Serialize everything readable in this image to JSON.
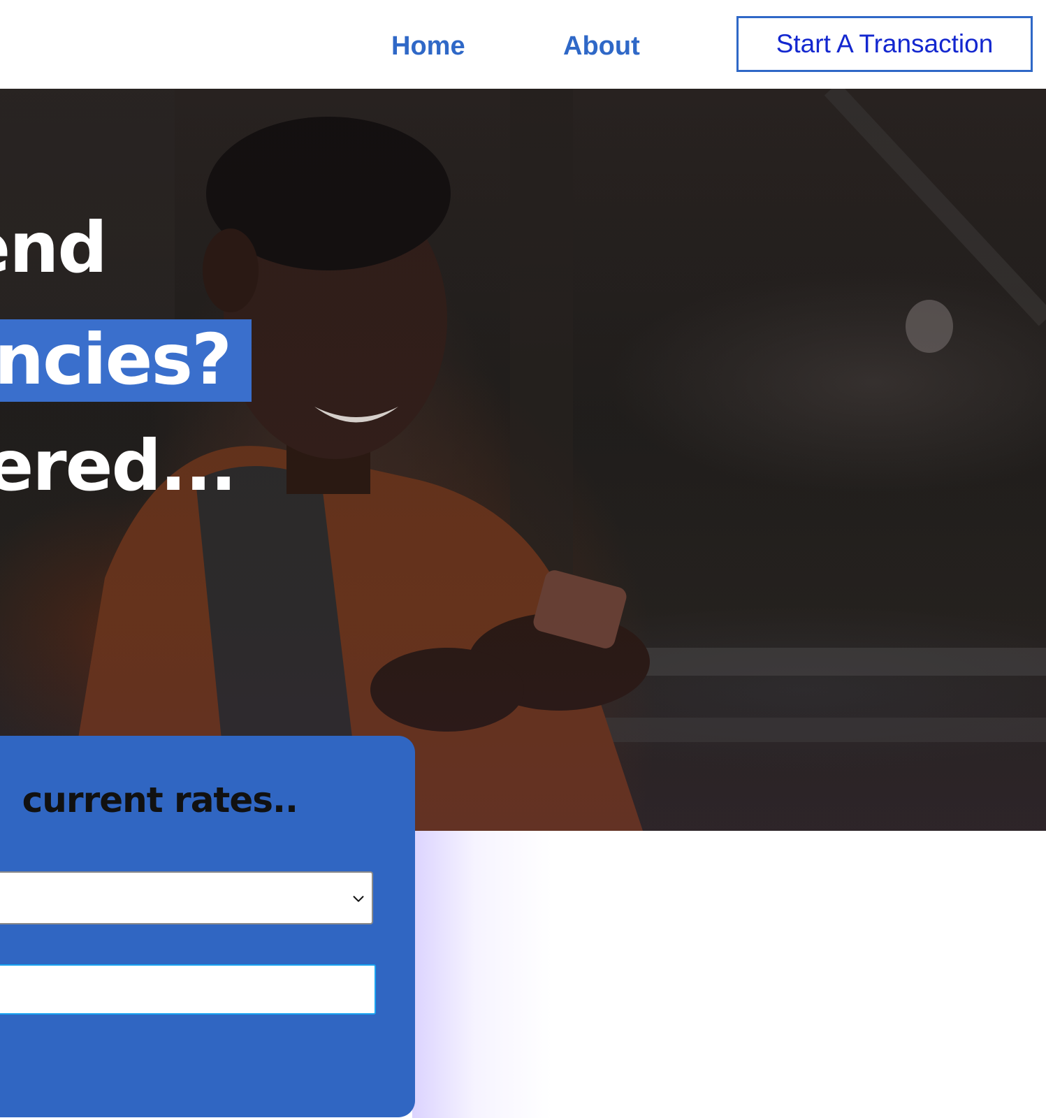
{
  "header": {
    "nav": {
      "home_label": "Home",
      "about_label": "About"
    },
    "cta_label": "Start A Transaction"
  },
  "hero": {
    "headline_line1": "end",
    "headline_line2": "ncies?",
    "headline_line3": "ered...",
    "highlight_color": "#3a6fcc"
  },
  "rates_card": {
    "heading": "current rates..",
    "currency_select": {
      "value": ""
    },
    "amount_input": {
      "value": "",
      "placeholder": ""
    }
  },
  "colors": {
    "brand_blue": "#3066c2",
    "nav_blue": "#2f68c7",
    "cta_text": "#1327cf",
    "input_focus": "#1aa3f0"
  },
  "icons": {
    "select_chevron": "chevron-down-icon"
  }
}
